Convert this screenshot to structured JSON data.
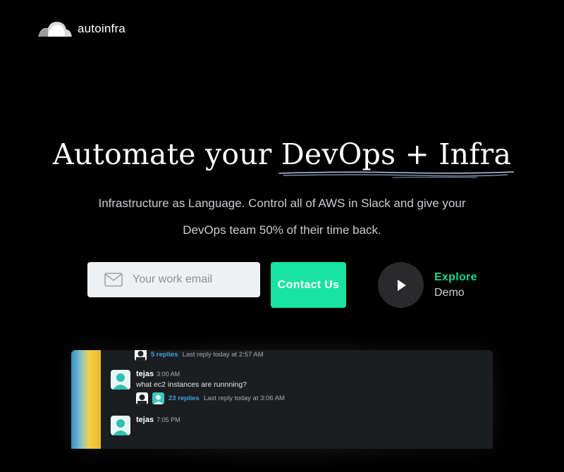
{
  "brand": {
    "name": "autoinfra"
  },
  "hero": {
    "headline_plain": "Automate your ",
    "headline_underlined": "DevOps + Infra",
    "subtitle_line1": "Infrastructure as Language. Control all of AWS in Slack and give your",
    "subtitle_line2": "DevOps team 50% of their time back."
  },
  "signup": {
    "email_placeholder": "Your work email",
    "contact_label": "Contact Us"
  },
  "demo": {
    "line1": "Explore",
    "line2": "Demo"
  },
  "slack_preview": {
    "top_thread": {
      "replies": "5 replies",
      "last_reply": "Last reply today at 2:57 AM"
    },
    "messages": [
      {
        "author": "tejas",
        "time": "3:00 AM",
        "text": "what ec2 instances are runnning?",
        "thread": {
          "replies": "23 replies",
          "last_reply": "Last reply today at 3:06 AM"
        }
      },
      {
        "author": "tejas",
        "time": "7:05 PM"
      }
    ]
  },
  "colors": {
    "accent": "#18e3a0",
    "background": "#000000",
    "link": "#3aa3e3"
  }
}
